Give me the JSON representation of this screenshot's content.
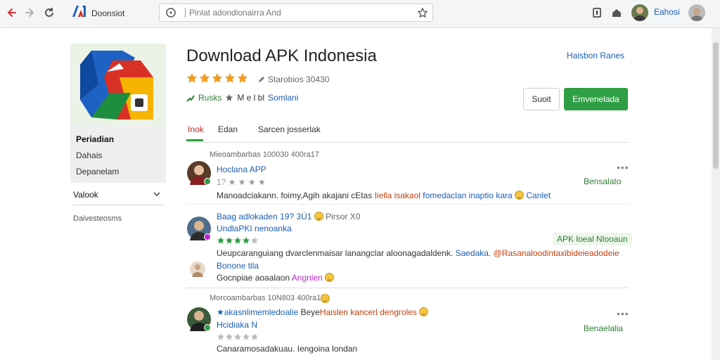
{
  "browser": {
    "brand_name": "Doonsiot",
    "address_placeholder": "Pinlat adondionairra And",
    "profile_name": "Eahosi"
  },
  "sidebar": {
    "items": [
      "Periadian",
      "Dahais",
      "Depanelam"
    ],
    "dropdown_label": "Valook",
    "footer": "Daivesteosms"
  },
  "app": {
    "title": "Download APK Indonesia",
    "rating_count": "Starobios 30430",
    "meta_primary": "Rusks",
    "meta_secondary": "M e l bl",
    "meta_link": "Somlani",
    "top_link": "Haisbon Ranes",
    "share_label": "Suoit",
    "install_label": "Emvenelada"
  },
  "tabs": [
    "Inok",
    "Edan",
    "Sarcen josserlak"
  ],
  "reviews": [
    {
      "date": "Mieoambarbas 100030 400ra17",
      "name": "Hoclana APP",
      "sub": "1? ★ ★ ★ ★",
      "stars": 0,
      "helpful": "Bensalato",
      "text_parts": [
        {
          "t": "Manoadciakann. foimy,Agih akajani cEtas ",
          "c": ""
        },
        {
          "t": "Iiella isakaol ",
          "c": "r"
        },
        {
          "t": "fomedaclan inaptio kara ",
          "c": "b"
        },
        {
          "t": "emoji",
          "c": "emoji"
        },
        {
          "t": " Canlet",
          "c": "b"
        }
      ]
    },
    {
      "date": "Baag adlokaden 19? 3Ú1",
      "date_tail": "Pirsor X0",
      "name": "UndlaPKI nenoanka",
      "stars": 4,
      "helpful": "APK loeal Nlooaun",
      "text_parts": [
        {
          "t": "Ueupcaranguiang dvarclenmaisar lanangclar aloonagadaldenk. ",
          "c": ""
        },
        {
          "t": "Saedaka. ",
          "c": "b"
        },
        {
          "t": "@Rasanaloodintaxibideieadodeie",
          "c": "r"
        }
      ],
      "reply_name": "Bonone tila",
      "reply_text": "Gocnpiae aoaalaon",
      "reply_link": "Angnlen"
    },
    {
      "date": "Morcoambarbas 10N803 400ra17",
      "name_parts": [
        {
          "t": "★akasnlimemledoalie ",
          "c": "b"
        },
        {
          "t": "Beye",
          "c": ""
        },
        {
          "t": "Haislen",
          "c": "r"
        },
        {
          "t": " kancerl dengroles",
          "c": "r"
        }
      ],
      "name2": "Hcidiaka  N",
      "stars": 0,
      "helpful": "Benaelalia",
      "text_parts": [
        {
          "t": "Canaramosadakuau. Iengoina londan",
          "c": ""
        }
      ]
    }
  ],
  "colors": {
    "accent": "#2f9e44",
    "link": "#1a5fb4",
    "star": "#f29b1d",
    "active_tab": "#c62828"
  }
}
